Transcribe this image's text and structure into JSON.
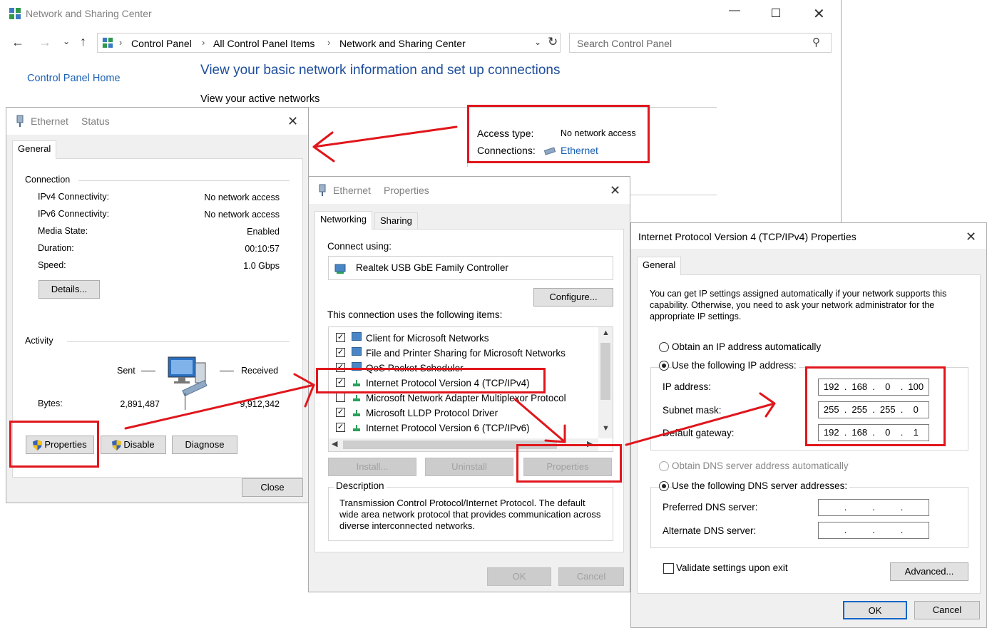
{
  "main_window": {
    "title": "Network and Sharing Center",
    "breadcrumb": [
      "Control Panel",
      "All Control Panel Items",
      "Network and Sharing Center"
    ],
    "search_placeholder": "Search Control Panel",
    "sidebar_home": "Control Panel Home",
    "heading": "View your basic network information and set up connections",
    "active_networks_label": "View your active networks",
    "access_type_label": "Access type:",
    "access_type_value": "No network access",
    "connections_label": "Connections:",
    "connections_value": "Ethernet"
  },
  "status_dialog": {
    "title_part1": "Ethernet",
    "title_part2": "Status",
    "tab": "General",
    "connection_group": "Connection",
    "rows": [
      {
        "label": "IPv4 Connectivity:",
        "value": "No network access"
      },
      {
        "label": "IPv6 Connectivity:",
        "value": "No network access"
      },
      {
        "label": "Media State:",
        "value": "Enabled"
      },
      {
        "label": "Duration:",
        "value": "00:10:57"
      },
      {
        "label": "Speed:",
        "value": "1.0 Gbps"
      }
    ],
    "details_button": "Details...",
    "activity_group": "Activity",
    "sent_label": "Sent",
    "received_label": "Received",
    "bytes_label": "Bytes:",
    "bytes_sent": "2,891,487",
    "bytes_received": "9,912,342",
    "properties_button": "Properties",
    "disable_button": "Disable",
    "diagnose_button": "Diagnose",
    "close_button": "Close"
  },
  "properties_dialog": {
    "title_part1": "Ethernet",
    "title_part2": "Properties",
    "tab_networking": "Networking",
    "tab_sharing": "Sharing",
    "connect_using_label": "Connect using:",
    "adapter": "Realtek USB GbE Family Controller",
    "configure_button": "Configure...",
    "items_label": "This connection uses the following items:",
    "items": [
      {
        "label": "Client for Microsoft Networks",
        "checked": true,
        "icon": "network-icon"
      },
      {
        "label": "File and Printer Sharing for Microsoft Networks",
        "checked": true,
        "icon": "network-icon"
      },
      {
        "label": "QoS Packet Scheduler",
        "checked": true,
        "icon": "network-icon"
      },
      {
        "label": "Internet Protocol Version 4 (TCP/IPv4)",
        "checked": true,
        "icon": "protocol-icon"
      },
      {
        "label": "Microsoft Network Adapter Multiplexor Protocol",
        "checked": false,
        "icon": "protocol-icon"
      },
      {
        "label": "Microsoft LLDP Protocol Driver",
        "checked": true,
        "icon": "protocol-icon"
      },
      {
        "label": "Internet Protocol Version 6 (TCP/IPv6)",
        "checked": true,
        "icon": "protocol-icon"
      }
    ],
    "install_button": "Install...",
    "uninstall_button": "Uninstall",
    "properties_button": "Properties",
    "description_group": "Description",
    "description_text": "Transmission Control Protocol/Internet Protocol. The default wide area network protocol that provides communication across diverse interconnected networks.",
    "ok_button": "OK",
    "cancel_button": "Cancel"
  },
  "ipv4_dialog": {
    "title": "Internet Protocol Version 4 (TCP/IPv4) Properties",
    "tab": "General",
    "intro": "You can get IP settings assigned automatically if your network supports this capability. Otherwise, you need to ask your network administrator for the appropriate IP settings.",
    "obtain_ip_auto": "Obtain an IP address automatically",
    "use_following_ip": "Use the following IP address:",
    "ip_address_label": "IP address:",
    "ip_address": [
      "192",
      "168",
      "0",
      "100"
    ],
    "subnet_label": "Subnet mask:",
    "subnet": [
      "255",
      "255",
      "255",
      "0"
    ],
    "gateway_label": "Default gateway:",
    "gateway": [
      "192",
      "168",
      "0",
      "1"
    ],
    "obtain_dns_auto": "Obtain DNS server address automatically",
    "use_following_dns": "Use the following DNS server addresses:",
    "preferred_dns_label": "Preferred DNS server:",
    "alternate_dns_label": "Alternate DNS server:",
    "validate_label": "Validate settings upon exit",
    "advanced_button": "Advanced...",
    "ok_button": "OK",
    "cancel_button": "Cancel"
  },
  "colors": {
    "annotation_red": "#e0161c",
    "link_blue": "#1a5fb4",
    "heading_blue": "#1e4e9c"
  }
}
